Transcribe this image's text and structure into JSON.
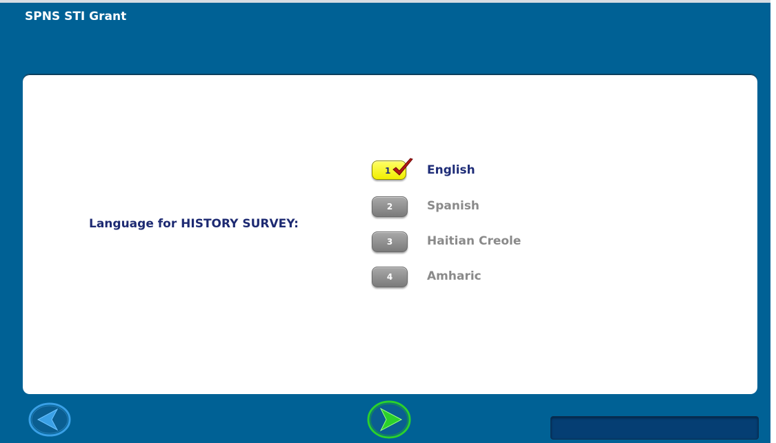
{
  "app": {
    "title": "SPNS STI Grant"
  },
  "question": {
    "label": "Language for HISTORY SURVEY:"
  },
  "options": [
    {
      "number": "1",
      "label": "English",
      "selected": true
    },
    {
      "number": "2",
      "label": "Spanish",
      "selected": false
    },
    {
      "number": "3",
      "label": "Haitian Creole",
      "selected": false
    },
    {
      "number": "4",
      "label": "Amharic",
      "selected": false
    }
  ],
  "nav": {
    "back_icon": "back-arrow-icon",
    "next_icon": "next-arrow-icon"
  },
  "progress": {
    "value": 0
  },
  "colors": {
    "background": "#006195",
    "question_text": "#1d2a72",
    "selected_badge": "#f5f200",
    "unselected_badge": "#8e8e8e",
    "checkmark": "#b11818",
    "next_arrow": "#2bd12b",
    "back_arrow": "#3aa0e6"
  }
}
